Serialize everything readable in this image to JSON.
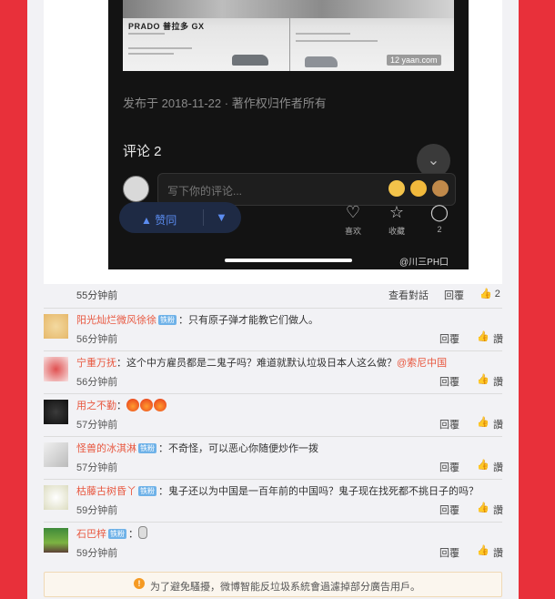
{
  "embed": {
    "brochure_brand": "PRADO 普拉多 GX",
    "brochure_watermark": "12 yaan.com",
    "published": "发布于 2018-11-22 · 著作权归作者所有",
    "comments_title": "评论 2",
    "fab_icon": "double-chevron-down-icon",
    "input_placeholder": "写下你的评论...",
    "vote_up_label": "赞同",
    "vote_up_icon": "triangle-up-icon",
    "vote_down_icon": "triangle-down-icon",
    "actions": [
      {
        "icon": "heart-icon",
        "label": "喜欢"
      },
      {
        "icon": "star-icon",
        "label": "收藏"
      },
      {
        "icon": "comment-bubble-icon",
        "label": "2"
      }
    ],
    "weibo_watermark": "@川三PH口"
  },
  "post_meta": {
    "time": "55分钟前",
    "view_convo": "查看對話",
    "reply": "回覆",
    "like_count": "2"
  },
  "comments": [
    {
      "user": "阳光灿烂微风徐徐",
      "badge": "铁粉",
      "text": "：只有原子弹才能教它们做人。",
      "time": "56分钟前",
      "reply": "回覆",
      "like": "讚"
    },
    {
      "user": "宁重万抚",
      "badge": "",
      "text": "：这个中方雇员都是二鬼子吗？难道就默认垃圾日本人这么做？",
      "mention": "@索尼中国",
      "time": "56分钟前",
      "reply": "回覆",
      "like": "讚"
    },
    {
      "user": "用之不勤",
      "badge": "",
      "text": "：",
      "time": "57分钟前",
      "reply": "回覆",
      "like": "讚"
    },
    {
      "user": "怪兽的冰淇淋",
      "badge": "铁粉",
      "text": "：不奇怪，可以恶心你随便炒作一拨",
      "time": "57分钟前",
      "reply": "回覆",
      "like": "讚"
    },
    {
      "user": "枯藤古树昏丫",
      "badge": "铁粉",
      "text": "：鬼子还以为中国是一百年前的中国吗？鬼子现在找死都不挑日子的吗？",
      "time": "59分钟前",
      "reply": "回覆",
      "like": "讚"
    },
    {
      "user": "石巴梓",
      "badge": "铁粉",
      "text": "：",
      "time": "59分钟前",
      "reply": "回覆",
      "like": "讚"
    }
  ],
  "notice": {
    "icon": "warning-icon",
    "text": "为了避免騷擾，微博智能反垃圾系統會過濾掉部分廣告用戶。"
  }
}
